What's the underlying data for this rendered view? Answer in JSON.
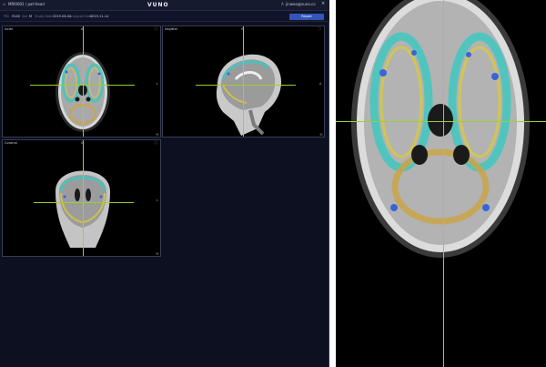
{
  "topbar": {
    "study_id": "MRI0001 / pat Head",
    "brand": "VUNO",
    "user_email": "jinwoo@vuno.co",
    "close_symbol": "×",
    "user_symbol": "A"
  },
  "subbar": {
    "id_label": "PID",
    "id_value": "9140",
    "sex_label": "Sex",
    "sex_value": "M",
    "study_date_label": "Study Date",
    "study_date_value": "2019-06-02",
    "analyzed_label": "Analyzed Date",
    "analyzed_value": "2019-11-14",
    "report_button": "Report"
  },
  "panels": {
    "axial": {
      "label": "Axial",
      "orient_top": "A",
      "orient_right": "L"
    },
    "sagittal": {
      "label": "Sagittal",
      "orient_top": "S",
      "orient_right": "A"
    },
    "coronal": {
      "label": "Coronal",
      "orient_top": "S",
      "orient_right": "L"
    }
  },
  "icons": {
    "expand": "⛶",
    "reset": "⟲"
  },
  "colors": {
    "app_bg": "#0d1020",
    "crosshair": "#9ad12d",
    "accent_button": "#3355b8",
    "overlay_cyan": "#3fc7c0",
    "overlay_yellow": "#d9c93a",
    "overlay_blue": "#3b63d8"
  }
}
